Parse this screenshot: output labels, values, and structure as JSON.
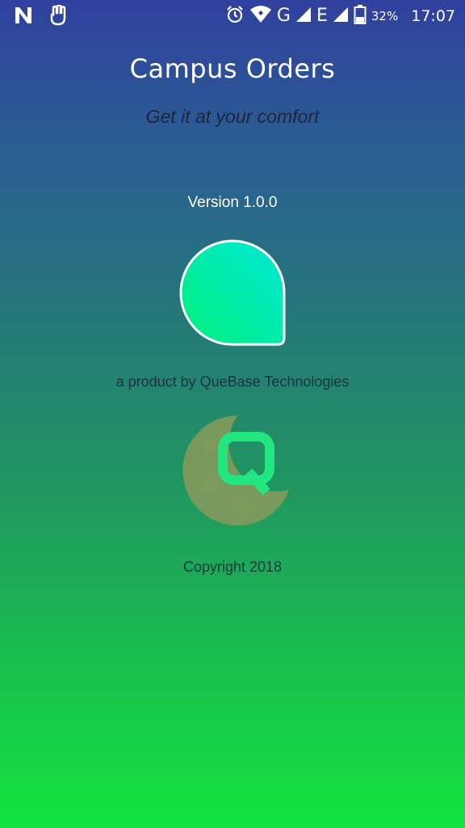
{
  "status_bar": {
    "left_icons": [
      "n-notification-icon",
      "hand-notification-icon"
    ],
    "alarm_icon": "alarm-clock-icon",
    "wifi_icon": "wifi-icon",
    "network_1": "G",
    "network_2": "E",
    "battery_percent": "32%",
    "time": "17:07"
  },
  "app": {
    "title": "Campus Orders",
    "tagline": "Get it at your comfort",
    "version": "Version 1.0.0",
    "byline": "a product by QueBase Technologies",
    "company_logo_letter": "Q",
    "copyright": "Copyright 2018"
  },
  "colors": {
    "gradient_top": "#30409e",
    "gradient_bottom": "#12e33f",
    "logo_gradient_start": "#00f07a",
    "logo_gradient_end": "#00e7d9",
    "company_logo_moon": "#7e9a5c",
    "company_logo_q": "#22e680"
  }
}
